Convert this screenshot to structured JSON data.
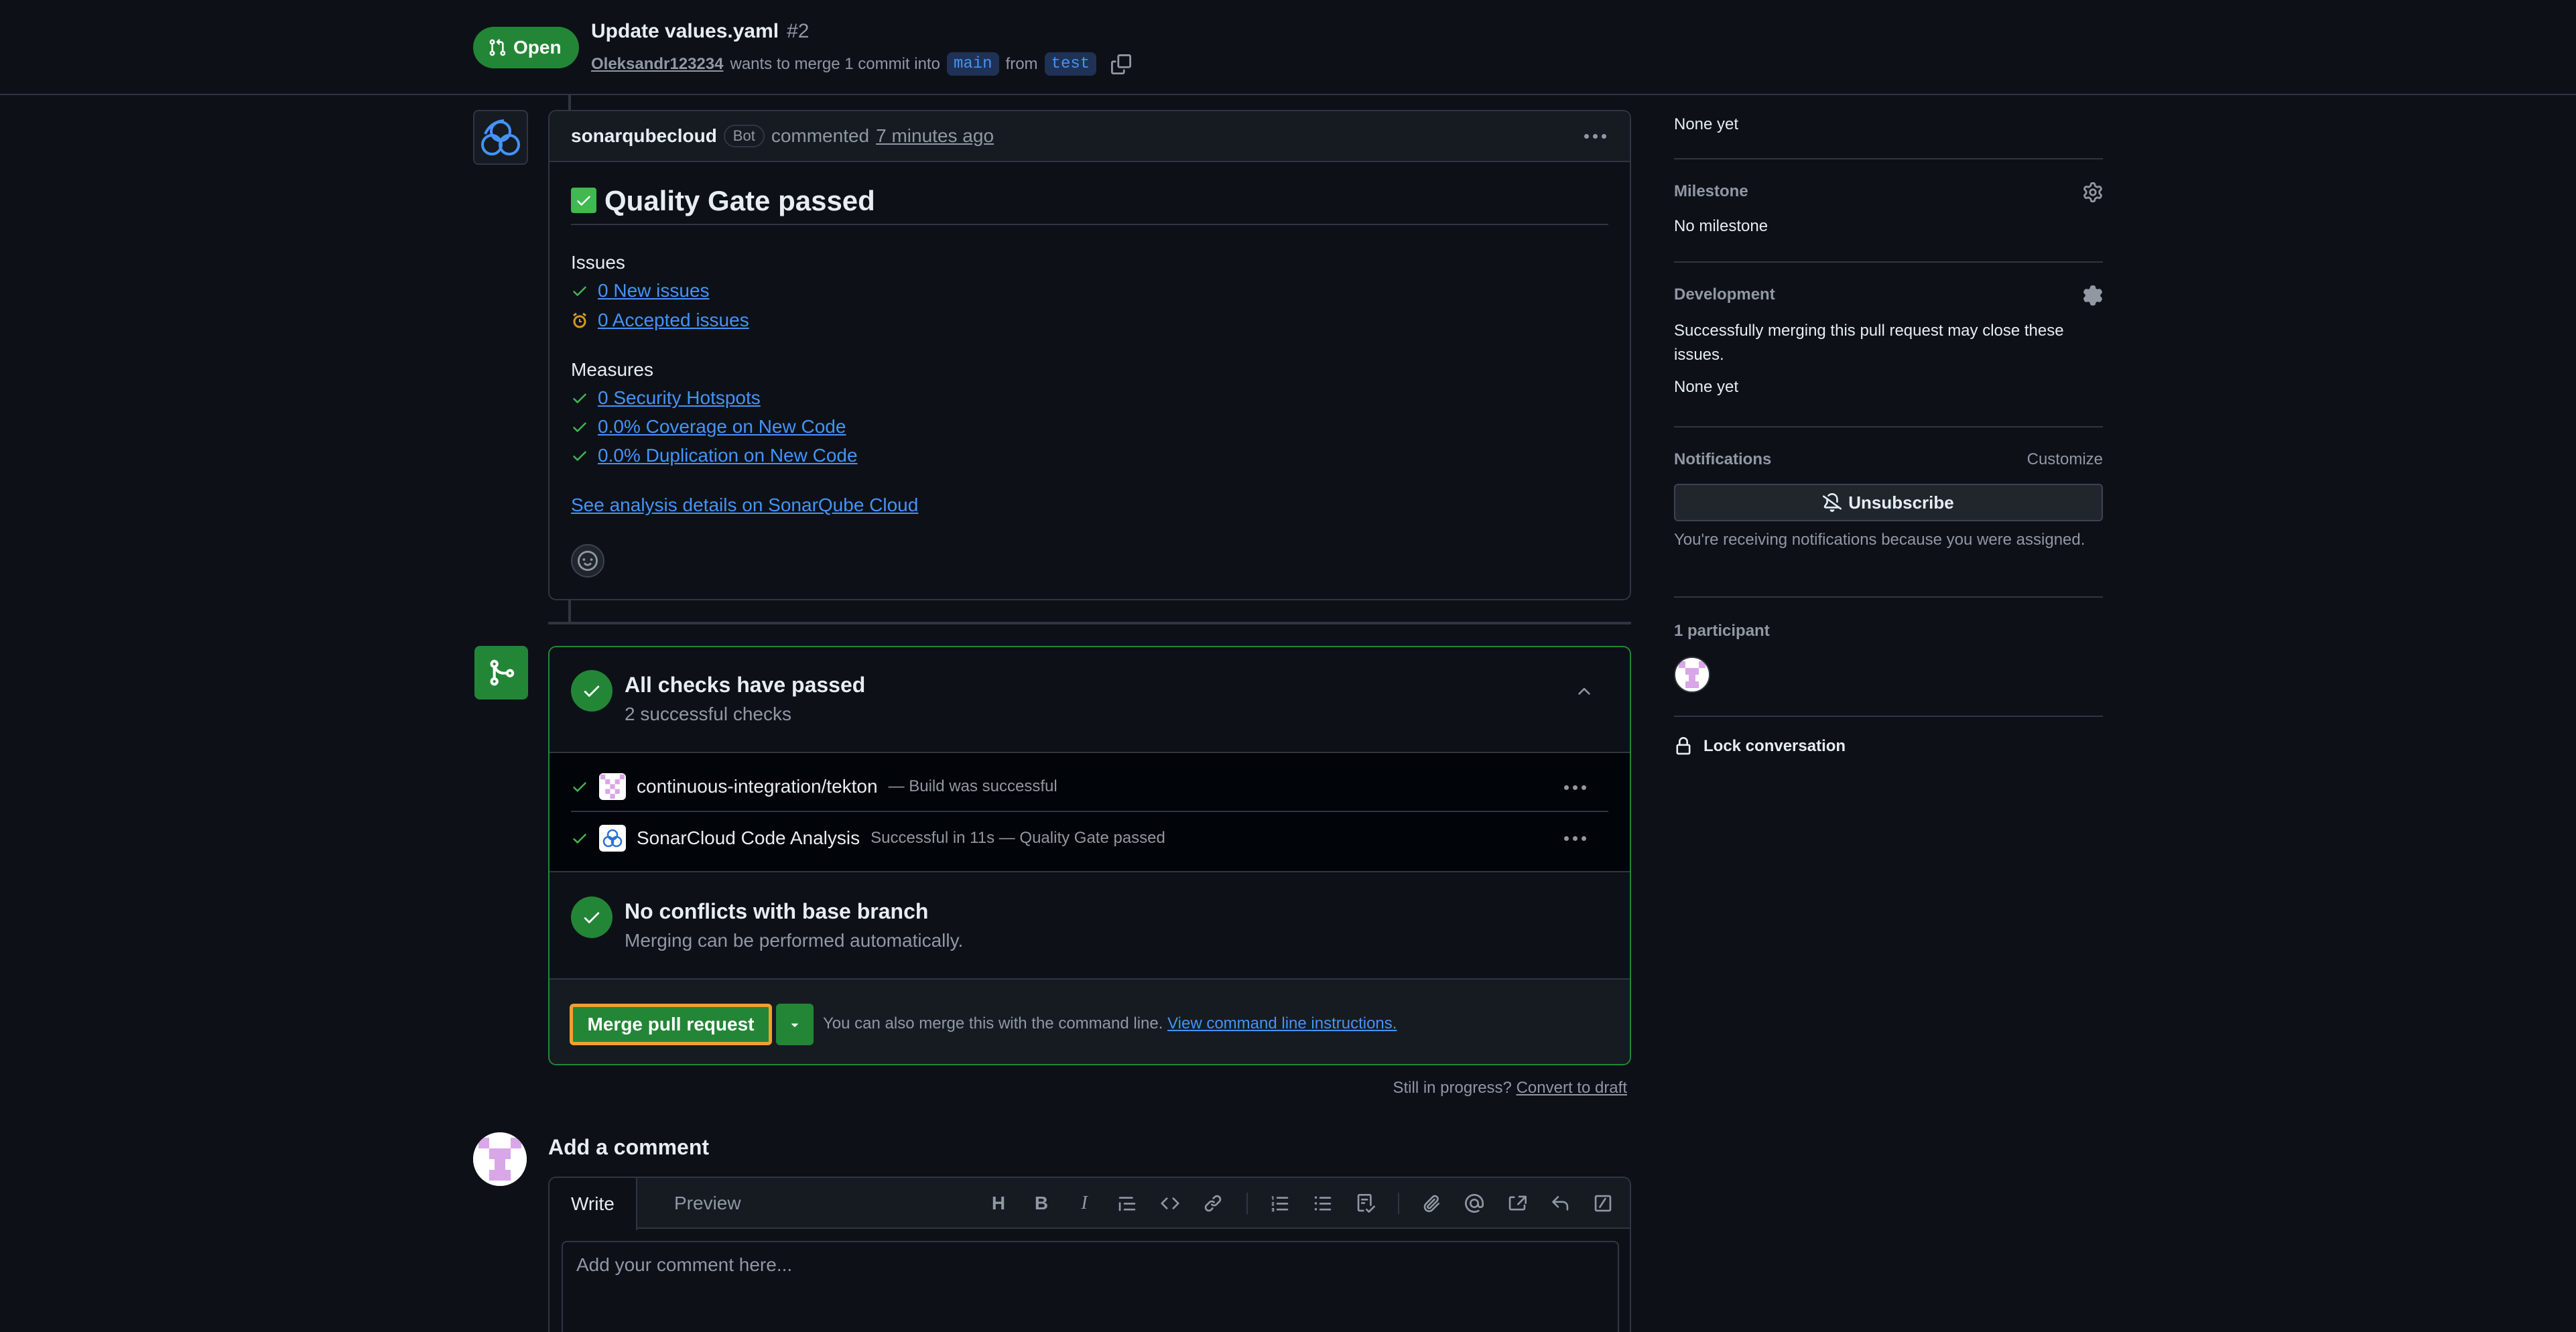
{
  "header": {
    "state": "Open",
    "title": "Update values.yaml",
    "number": "#2",
    "author": "Oleksandr123234",
    "merge_text": "wants to merge 1 commit into",
    "base_branch": "main",
    "from_text": "from",
    "head_branch": "test"
  },
  "comment": {
    "author": "sonarqubecloud",
    "bot_label": "Bot",
    "action": "commented",
    "time": "7 minutes ago",
    "heading": "Quality Gate passed",
    "issues_label": "Issues",
    "issues": [
      {
        "icon": "check-icon",
        "text": "0 New issues"
      },
      {
        "icon": "accepted-issue-icon",
        "text": "0 Accepted issues"
      }
    ],
    "measures_label": "Measures",
    "measures": [
      {
        "icon": "check-icon",
        "text": "0 Security Hotspots"
      },
      {
        "icon": "check-icon",
        "text": "0.0% Coverage on New Code"
      },
      {
        "icon": "check-icon",
        "text": "0.0% Duplication on New Code"
      }
    ],
    "details_link": "See analysis details on SonarQube Cloud"
  },
  "checks": {
    "title": "All checks have passed",
    "subtitle": "2 successful checks",
    "items": [
      {
        "name": "continuous-integration/tekton",
        "description": "— Build was successful"
      },
      {
        "name": "SonarCloud Code Analysis",
        "description": "Successful in 11s — Quality Gate passed"
      }
    ]
  },
  "conflicts": {
    "title": "No conflicts with base branch",
    "subtitle": "Merging can be performed automatically."
  },
  "merge": {
    "button": "Merge pull request",
    "hint": "You can also merge this with the command line.",
    "link": "View command line instructions."
  },
  "draft": {
    "prefix": "Still in progress?",
    "link": "Convert to draft"
  },
  "add_comment": {
    "title": "Add a comment",
    "tab_write": "Write",
    "tab_preview": "Preview",
    "placeholder": "Add your comment here..."
  },
  "sidebar": {
    "reviewers_value": "None yet",
    "milestone_label": "Milestone",
    "milestone_value": "No milestone",
    "development_label": "Development",
    "development_desc": "Successfully merging this pull request may close these issues.",
    "development_value": "None yet",
    "notifications_label": "Notifications",
    "customize": "Customize",
    "unsubscribe": "Unsubscribe",
    "notifications_note": "You're receiving notifications because you were assigned.",
    "participants_label": "1 participant",
    "lock": "Lock conversation"
  },
  "colors": {
    "background": "#0d1117",
    "accent_green": "#238636",
    "link_blue": "#4493f8",
    "highlight_orange": "#f0a030"
  }
}
